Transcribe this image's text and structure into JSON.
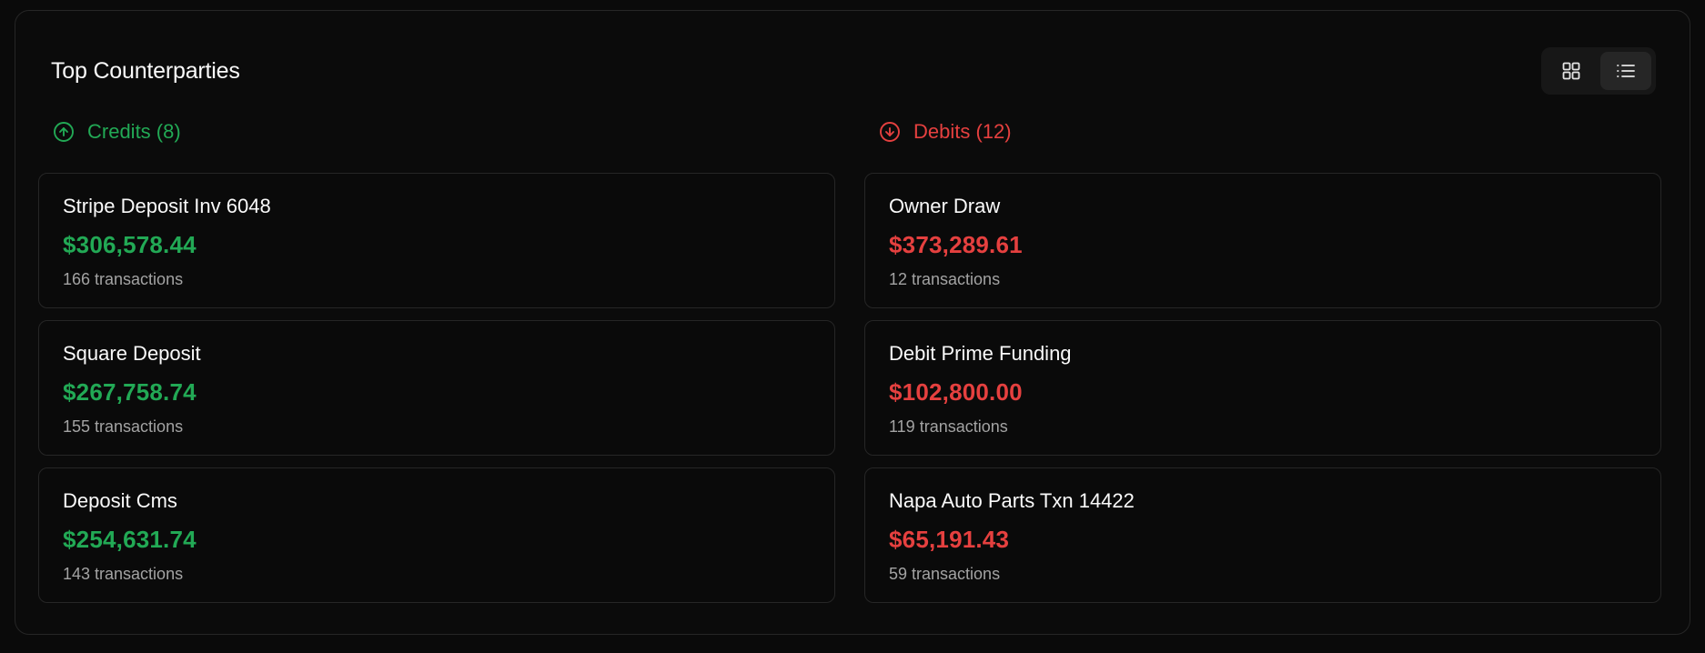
{
  "title": "Top Counterparties",
  "view_toggle": {
    "options": [
      {
        "icon": "grid-icon",
        "active": false
      },
      {
        "icon": "list-icon",
        "active": true
      }
    ]
  },
  "colors": {
    "credit": "#22a955",
    "debit": "#e5403f",
    "background": "#0a0a0a",
    "border": "#262626"
  },
  "credits": {
    "label": "Credits (8)",
    "icon": "arrow-up-circle-icon",
    "items": [
      {
        "name": "Stripe Deposit Inv 6048",
        "amount": "$306,578.44",
        "count": "166 transactions"
      },
      {
        "name": "Square Deposit",
        "amount": "$267,758.74",
        "count": "155 transactions"
      },
      {
        "name": "Deposit Cms",
        "amount": "$254,631.74",
        "count": "143 transactions"
      }
    ]
  },
  "debits": {
    "label": "Debits (12)",
    "icon": "arrow-down-circle-icon",
    "items": [
      {
        "name": "Owner Draw",
        "amount": "$373,289.61",
        "count": "12 transactions"
      },
      {
        "name": "Debit Prime Funding",
        "amount": "$102,800.00",
        "count": "119 transactions"
      },
      {
        "name": "Napa Auto Parts Txn 14422",
        "amount": "$65,191.43",
        "count": "59 transactions"
      }
    ]
  }
}
